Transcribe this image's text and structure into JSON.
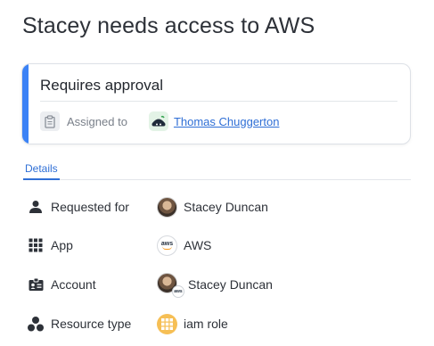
{
  "page": {
    "title": "Stacey needs access to AWS"
  },
  "approval_card": {
    "status": "Requires approval",
    "assigned_to_label": "Assigned to",
    "assignee_name": "Thomas Chuggerton",
    "accent_color": "#3b82f6"
  },
  "tabs": [
    {
      "label": "Details",
      "active": true
    }
  ],
  "details": [
    {
      "label": "Requested for",
      "icon": "person-icon",
      "value": "Stacey Duncan",
      "value_icon": "user-avatar"
    },
    {
      "label": "App",
      "icon": "grid-icon",
      "value": "AWS",
      "value_icon": "aws-logo-icon"
    },
    {
      "label": "Account",
      "icon": "id-card-icon",
      "value": "Stacey Duncan",
      "value_icon": "user-avatar-with-aws-badge"
    },
    {
      "label": "Resource type",
      "icon": "cluster-icon",
      "value": "iam role",
      "value_icon": "grid-badge-icon"
    }
  ]
}
